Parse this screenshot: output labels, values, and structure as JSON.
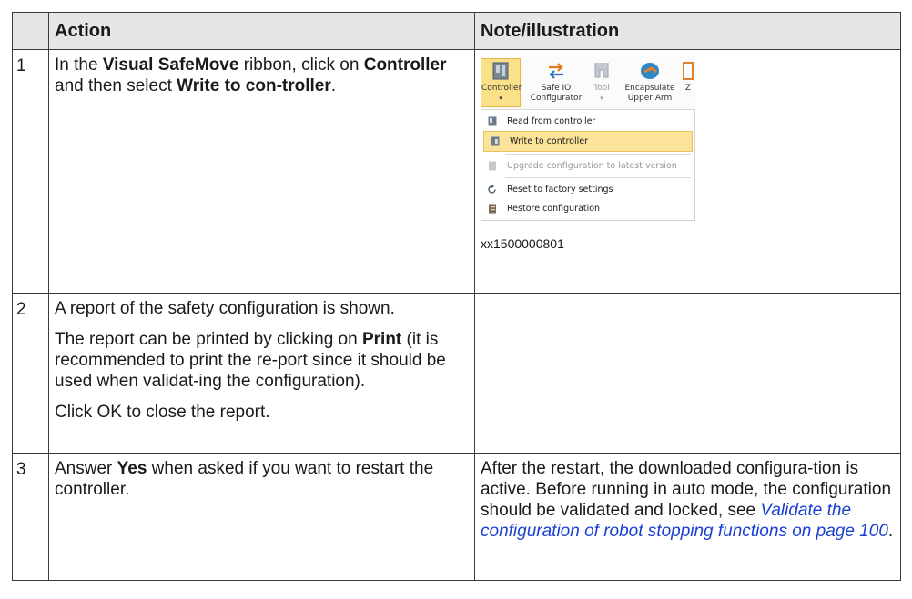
{
  "header": {
    "col1": "",
    "col2": "Action",
    "col3": "Note/illustration"
  },
  "rows": [
    {
      "num": "1",
      "action": {
        "t1": "In the ",
        "b1": "Visual SafeMove",
        "t2": " ribbon, click on ",
        "b2": "Controller",
        "t3": " and then select ",
        "b3": "Write to con-troller",
        "t4": "."
      },
      "note": {
        "ribbon": {
          "controller": "Controller",
          "safe_io_1": "Safe IO",
          "safe_io_2": "Configurator",
          "tool": "Tool",
          "encapsulate_1": "Encapsulate",
          "encapsulate_2": "Upper Arm",
          "z": "Z"
        },
        "menu": [
          "Read from controller",
          "Write to controller",
          "Upgrade configuration to latest version",
          "Reset to factory settings",
          "Restore configuration"
        ],
        "caption": "xx1500000801"
      }
    },
    {
      "num": "2",
      "action": {
        "p1": "A report of the safety configuration is shown.",
        "p2_t1": "The report can be printed by clicking on ",
        "p2_b1": "Print",
        "p2_t2": " (it is recommended to print the re-port since it should be used when validat-ing the configuration).",
        "p3": "Click OK to close the report."
      },
      "note": ""
    },
    {
      "num": "3",
      "action": {
        "t1": "Answer ",
        "b1": "Yes",
        "t2": " when asked if you want to restart the controller."
      },
      "note": {
        "text": "After the restart, the downloaded configura-tion is active. Before running in auto mode, the configuration should be validated and locked, see ",
        "link": "Validate the configuration of robot stopping functions on page 100",
        "end": "."
      }
    }
  ]
}
